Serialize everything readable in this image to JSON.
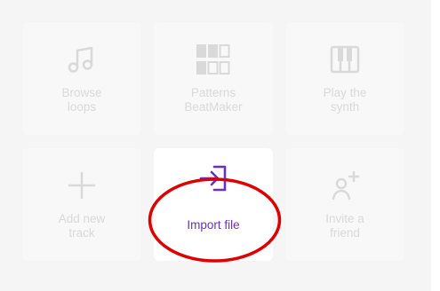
{
  "colors": {
    "accent": "#6b2fc3",
    "disabled": "#d9d9d9",
    "annotation": "#e00000"
  },
  "tiles": [
    {
      "lines": [
        "Browse",
        "loops"
      ],
      "icon": "music-note-icon"
    },
    {
      "lines": [
        "Patterns",
        "BeatMaker"
      ],
      "icon": "pattern-grid-icon"
    },
    {
      "lines": [
        "Play the",
        "synth"
      ],
      "icon": "piano-keys-icon"
    },
    {
      "lines": [
        "Add new",
        "track"
      ],
      "icon": "plus-icon"
    },
    {
      "lines": [
        "Import file"
      ],
      "icon": "import-icon"
    },
    {
      "lines": [
        "Invite a",
        "friend"
      ],
      "icon": "add-person-icon"
    }
  ]
}
